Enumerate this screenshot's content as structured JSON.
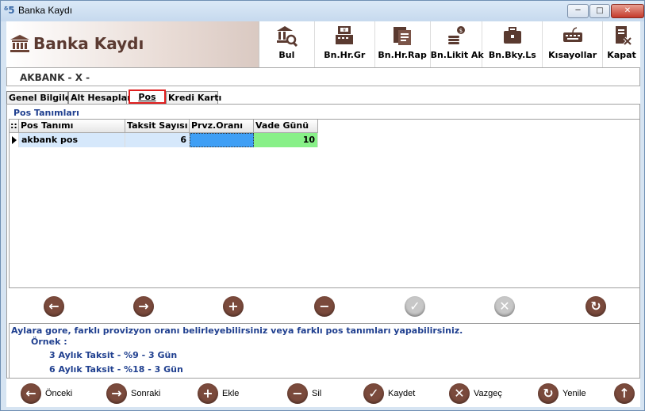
{
  "window": {
    "title": "Banka Kaydı",
    "min_glyph": "─",
    "max_glyph": "□",
    "close_glyph": "✕"
  },
  "header": {
    "title": "Banka Kaydı",
    "icon": "bank-icon"
  },
  "toolbar": [
    {
      "label": "Bul",
      "icon": "search-icon"
    },
    {
      "label": "Bn.Hr.Gr",
      "icon": "cash-register-icon"
    },
    {
      "label": "Bn.Hr.Rap",
      "icon": "report-icon"
    },
    {
      "label": "Bn.Likit Ak",
      "icon": "coins-icon"
    },
    {
      "label": "Bn.Bky.Ls",
      "icon": "briefcase-icon"
    },
    {
      "label": "Kısayollar",
      "icon": "keyboard-icon"
    },
    {
      "label": "Kapat",
      "icon": "close-document-icon"
    }
  ],
  "record": {
    "title": "AKBANK  -  X  -"
  },
  "tabs": [
    {
      "label": "Genel Bilgiler",
      "active": false
    },
    {
      "label": "Alt Hesaplar",
      "active": false
    },
    {
      "label": "Pos",
      "active": true
    },
    {
      "label": "Kredi Kartı",
      "active": false
    }
  ],
  "pos": {
    "group_title": "Pos Tanımları",
    "indicator_header": "::",
    "columns": [
      "Pos Tanımı",
      "Taksit Sayısı",
      "Prvz.Oranı",
      "Vade Günü"
    ],
    "rows": [
      {
        "pos_tanimi": "akbank pos",
        "taksit_sayisi": "6",
        "prvz_orani": "",
        "vade_gunu": "10"
      }
    ]
  },
  "navbar": [
    {
      "name": "prev",
      "glyph": "←",
      "enabled": true
    },
    {
      "name": "next",
      "glyph": "→",
      "enabled": true
    },
    {
      "name": "add",
      "glyph": "+",
      "enabled": true
    },
    {
      "name": "delete",
      "glyph": "−",
      "enabled": true
    },
    {
      "name": "confirm",
      "glyph": "✓",
      "enabled": false
    },
    {
      "name": "cancel",
      "glyph": "✕",
      "enabled": false
    },
    {
      "name": "refresh",
      "glyph": "↻",
      "enabled": true
    }
  ],
  "info": {
    "line1": "Aylara gore, farklı provizyon oranı belirleyebilirsiniz veya farklı pos tanımları yapabilirsiniz.",
    "line2": "Örnek :",
    "line3": "3 Aylık Taksit  - %9  - 3 Gün",
    "line4": "6 Aylık Taksit  - %18 - 3 Gün"
  },
  "bottombar": [
    {
      "label": "Önceki",
      "glyph": "←"
    },
    {
      "label": "Sonraki",
      "glyph": "→"
    },
    {
      "label": "Ekle",
      "glyph": "+"
    },
    {
      "label": "Sil",
      "glyph": "−"
    },
    {
      "label": "Kaydet",
      "glyph": "✓"
    },
    {
      "label": "Vazgeç",
      "glyph": "✕"
    },
    {
      "label": "Yenile",
      "glyph": "↻"
    },
    {
      "label": "",
      "glyph": "↑"
    }
  ],
  "colors": {
    "accent": "#7a4a3c",
    "prvz_cell": "#3f9ff5",
    "vade_cell": "#88f088",
    "selected_row": "#d6e8fb",
    "info_text": "#1f3f8f"
  }
}
